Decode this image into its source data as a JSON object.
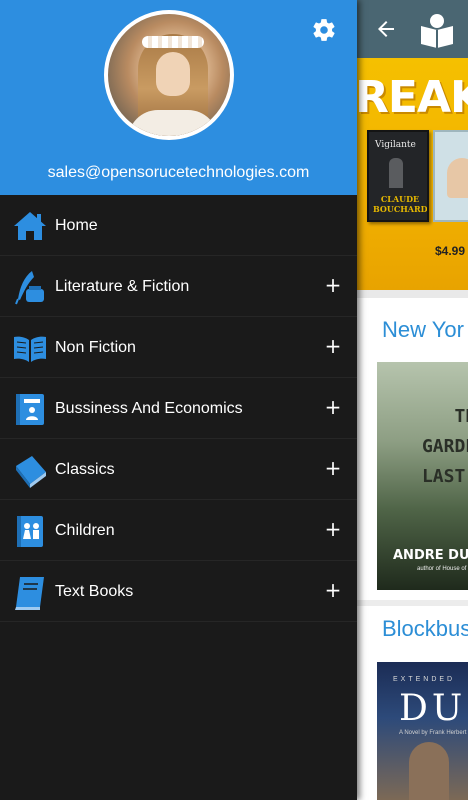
{
  "drawer": {
    "email": "sales@opensorucetechnologies.com",
    "settings_icon": "gear-icon",
    "menu": [
      {
        "label": "Home",
        "icon": "home-icon",
        "expandable": false
      },
      {
        "label": "Literature & Fiction",
        "icon": "quill-ink-icon",
        "expandable": true,
        "expand_symbol": "+"
      },
      {
        "label": "Non Fiction",
        "icon": "open-book-icon",
        "expandable": true,
        "expand_symbol": "+"
      },
      {
        "label": "Bussiness And Economics",
        "icon": "business-book-icon",
        "expandable": true,
        "expand_symbol": "+"
      },
      {
        "label": "Classics",
        "icon": "classic-book-icon",
        "expandable": true,
        "expand_symbol": "+"
      },
      {
        "label": "Children",
        "icon": "children-book-icon",
        "expandable": true,
        "expand_symbol": "+"
      },
      {
        "label": "Text Books",
        "icon": "text-book-icon",
        "expandable": true,
        "expand_symbol": "+"
      }
    ]
  },
  "app": {
    "back_icon": "arrow-back-icon",
    "logo_icon": "book-logo-icon",
    "banner": {
      "headline": "REAKO",
      "book1_title": "Vigilante",
      "book1_author": "CLAUDE BOUCHARD",
      "price": "$4.99"
    },
    "sections": [
      {
        "title": "New Yor",
        "cover_title": "THE GARDEN LAST D",
        "cover_author": "ANDRE DU",
        "cover_sub": "author of House of"
      },
      {
        "title": "Blockbus",
        "cover_top": "EXTENDED",
        "cover_title": "DU",
        "cover_sub": "A Novel by Frank Herbert"
      }
    ]
  },
  "colors": {
    "drawer_header": "#2d8ee0",
    "drawer_background": "#1a1a1a",
    "icon_blue": "#2d8ee0",
    "toolbar": "#4a6672",
    "section_title": "#2c8ed6"
  }
}
